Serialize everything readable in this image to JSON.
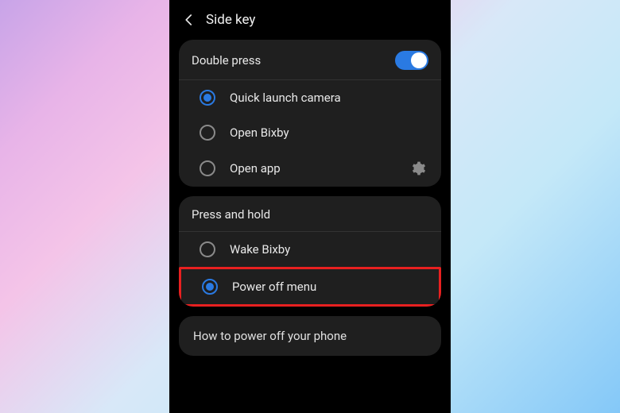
{
  "header": {
    "title": "Side key"
  },
  "doublePress": {
    "title": "Double press",
    "toggleOn": true,
    "options": [
      {
        "label": "Quick launch camera",
        "checked": true,
        "hasGear": false
      },
      {
        "label": "Open Bixby",
        "checked": false,
        "hasGear": false
      },
      {
        "label": "Open app",
        "checked": false,
        "hasGear": true
      }
    ]
  },
  "pressHold": {
    "title": "Press and hold",
    "options": [
      {
        "label": "Wake Bixby",
        "checked": false,
        "highlight": false
      },
      {
        "label": "Power off menu",
        "checked": true,
        "highlight": true
      }
    ]
  },
  "info": {
    "label": "How to power off your phone"
  }
}
